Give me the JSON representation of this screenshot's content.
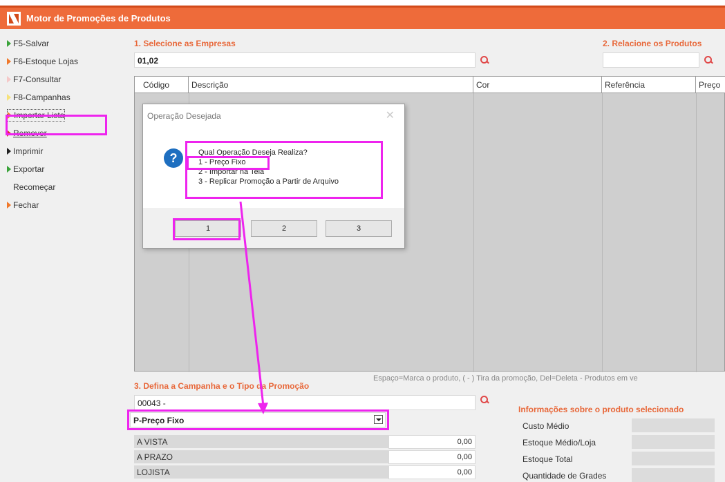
{
  "window": {
    "title": "Motor de Promoções de Produtos"
  },
  "sidebar": {
    "items": [
      {
        "label": "F5-Salvar",
        "color": "green"
      },
      {
        "label": "F6-Estoque Lojas",
        "color": "orange"
      },
      {
        "label": "F7-Consultar",
        "color": "pink"
      },
      {
        "label": "F8-Campanhas",
        "color": "yellow"
      },
      {
        "label": "Importar Lista",
        "color": "orange"
      },
      {
        "label": "Remover",
        "color": "red"
      },
      {
        "label": "Imprimir",
        "color": "black"
      },
      {
        "label": "Exportar",
        "color": "green"
      },
      {
        "label": "Recomeçar",
        "color": "none"
      },
      {
        "label": "Fechar",
        "color": "orange"
      }
    ]
  },
  "empresas": {
    "title": "1. Selecione as Empresas",
    "value": "01,02"
  },
  "produtos": {
    "title": "2. Relacione os Produtos",
    "value": ""
  },
  "grid": {
    "columns": [
      "Código",
      "Descrição",
      "Cor",
      "Referência",
      "Preço"
    ]
  },
  "dialog": {
    "title": "Operação Desejada",
    "question": "Qual Operação Deseja Realiza?",
    "options": [
      "1 - Preço Fixo",
      "2 - Importar na Tela",
      "3 - Replicar Promoção a Partir de Arquivo"
    ],
    "buttons": [
      "1",
      "2",
      "3"
    ]
  },
  "campanha": {
    "title": "3. Defina a Campanha e o Tipo da Promoção",
    "hint": "Espaço=Marca o produto, ( - ) Tira da promoção, Del=Deleta - Produtos em ve",
    "code": "00043 -",
    "tipo": "P-Preço Fixo"
  },
  "precos": [
    {
      "label": "A VISTA",
      "value": "0,00"
    },
    {
      "label": "A PRAZO",
      "value": "0,00"
    },
    {
      "label": "LOJISTA",
      "value": "0,00"
    }
  ],
  "info": {
    "title": "Informações sobre o produto selecionado",
    "labels": [
      "Custo Médio",
      "Estoque Médio/Loja",
      "Estoque Total",
      "Quantidade de Grades"
    ]
  },
  "colors": {
    "accent": "#ee6b3a",
    "highlight": "#ee24ee"
  }
}
